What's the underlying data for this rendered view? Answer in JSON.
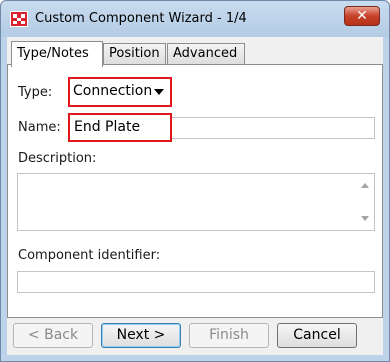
{
  "window": {
    "title": "Custom Component Wizard - 1/4",
    "close_label": "✕"
  },
  "tabs": [
    {
      "label": "Type/Notes",
      "active": true
    },
    {
      "label": "Position",
      "active": false
    },
    {
      "label": "Advanced",
      "active": false
    }
  ],
  "form": {
    "type_label": "Type:",
    "type_value": "Connection",
    "name_label": "Name:",
    "name_value": "End Plate",
    "description_label": "Description:",
    "description_value": "",
    "identifier_label": "Component identifier:",
    "identifier_value": ""
  },
  "buttons": {
    "back": "< Back",
    "next": "Next >",
    "finish": "Finish",
    "cancel": "Cancel"
  },
  "colors": {
    "highlight": "#e0161b",
    "close_button": "#c8412a",
    "titlebar": "#bcd3ea"
  }
}
